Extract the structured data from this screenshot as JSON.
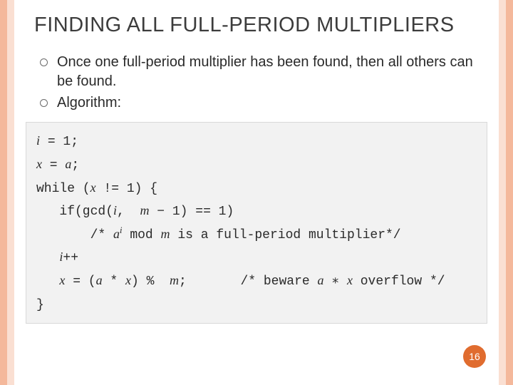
{
  "title": "FINDING ALL FULL-PERIOD MULTIPLIERS",
  "bullets": [
    "Once one full-period multiplier has been found, then all others can be found.",
    "Algorithm:"
  ],
  "code": {
    "line1_a": "i",
    "line1_b": " = 1;",
    "line2_a": "x",
    "line2_b": " = ",
    "line2_c": "a",
    "line2_d": ";",
    "line3_a": "while (",
    "line3_b": "x",
    "line3_c": " != 1) {",
    "line4_a": "   if(gcd(",
    "line4_b": "i",
    "line4_c": ",  ",
    "line4_d": "m",
    "line4_e": " − 1) == 1)",
    "line5_a": "       /* ",
    "line5_b": "a",
    "line5_sup": "i",
    "line5_c": " mod ",
    "line5_d": "m",
    "line5_e": " is a full-period multiplier*/",
    "line6_a": "   ",
    "line6_b": "i",
    "line6_c": "++",
    "line7_a": "   ",
    "line7_b": "x",
    "line7_c": " = (",
    "line7_d": "a",
    "line7_e": " * ",
    "line7_f": "x",
    "line7_g": ") %  ",
    "line7_h": "m",
    "line7_i": ";       /* beware ",
    "line7_j": "a",
    "line7_k": " ∗ ",
    "line7_l": "x",
    "line7_m": " overflow */",
    "line8": "}"
  },
  "page_number": "16"
}
